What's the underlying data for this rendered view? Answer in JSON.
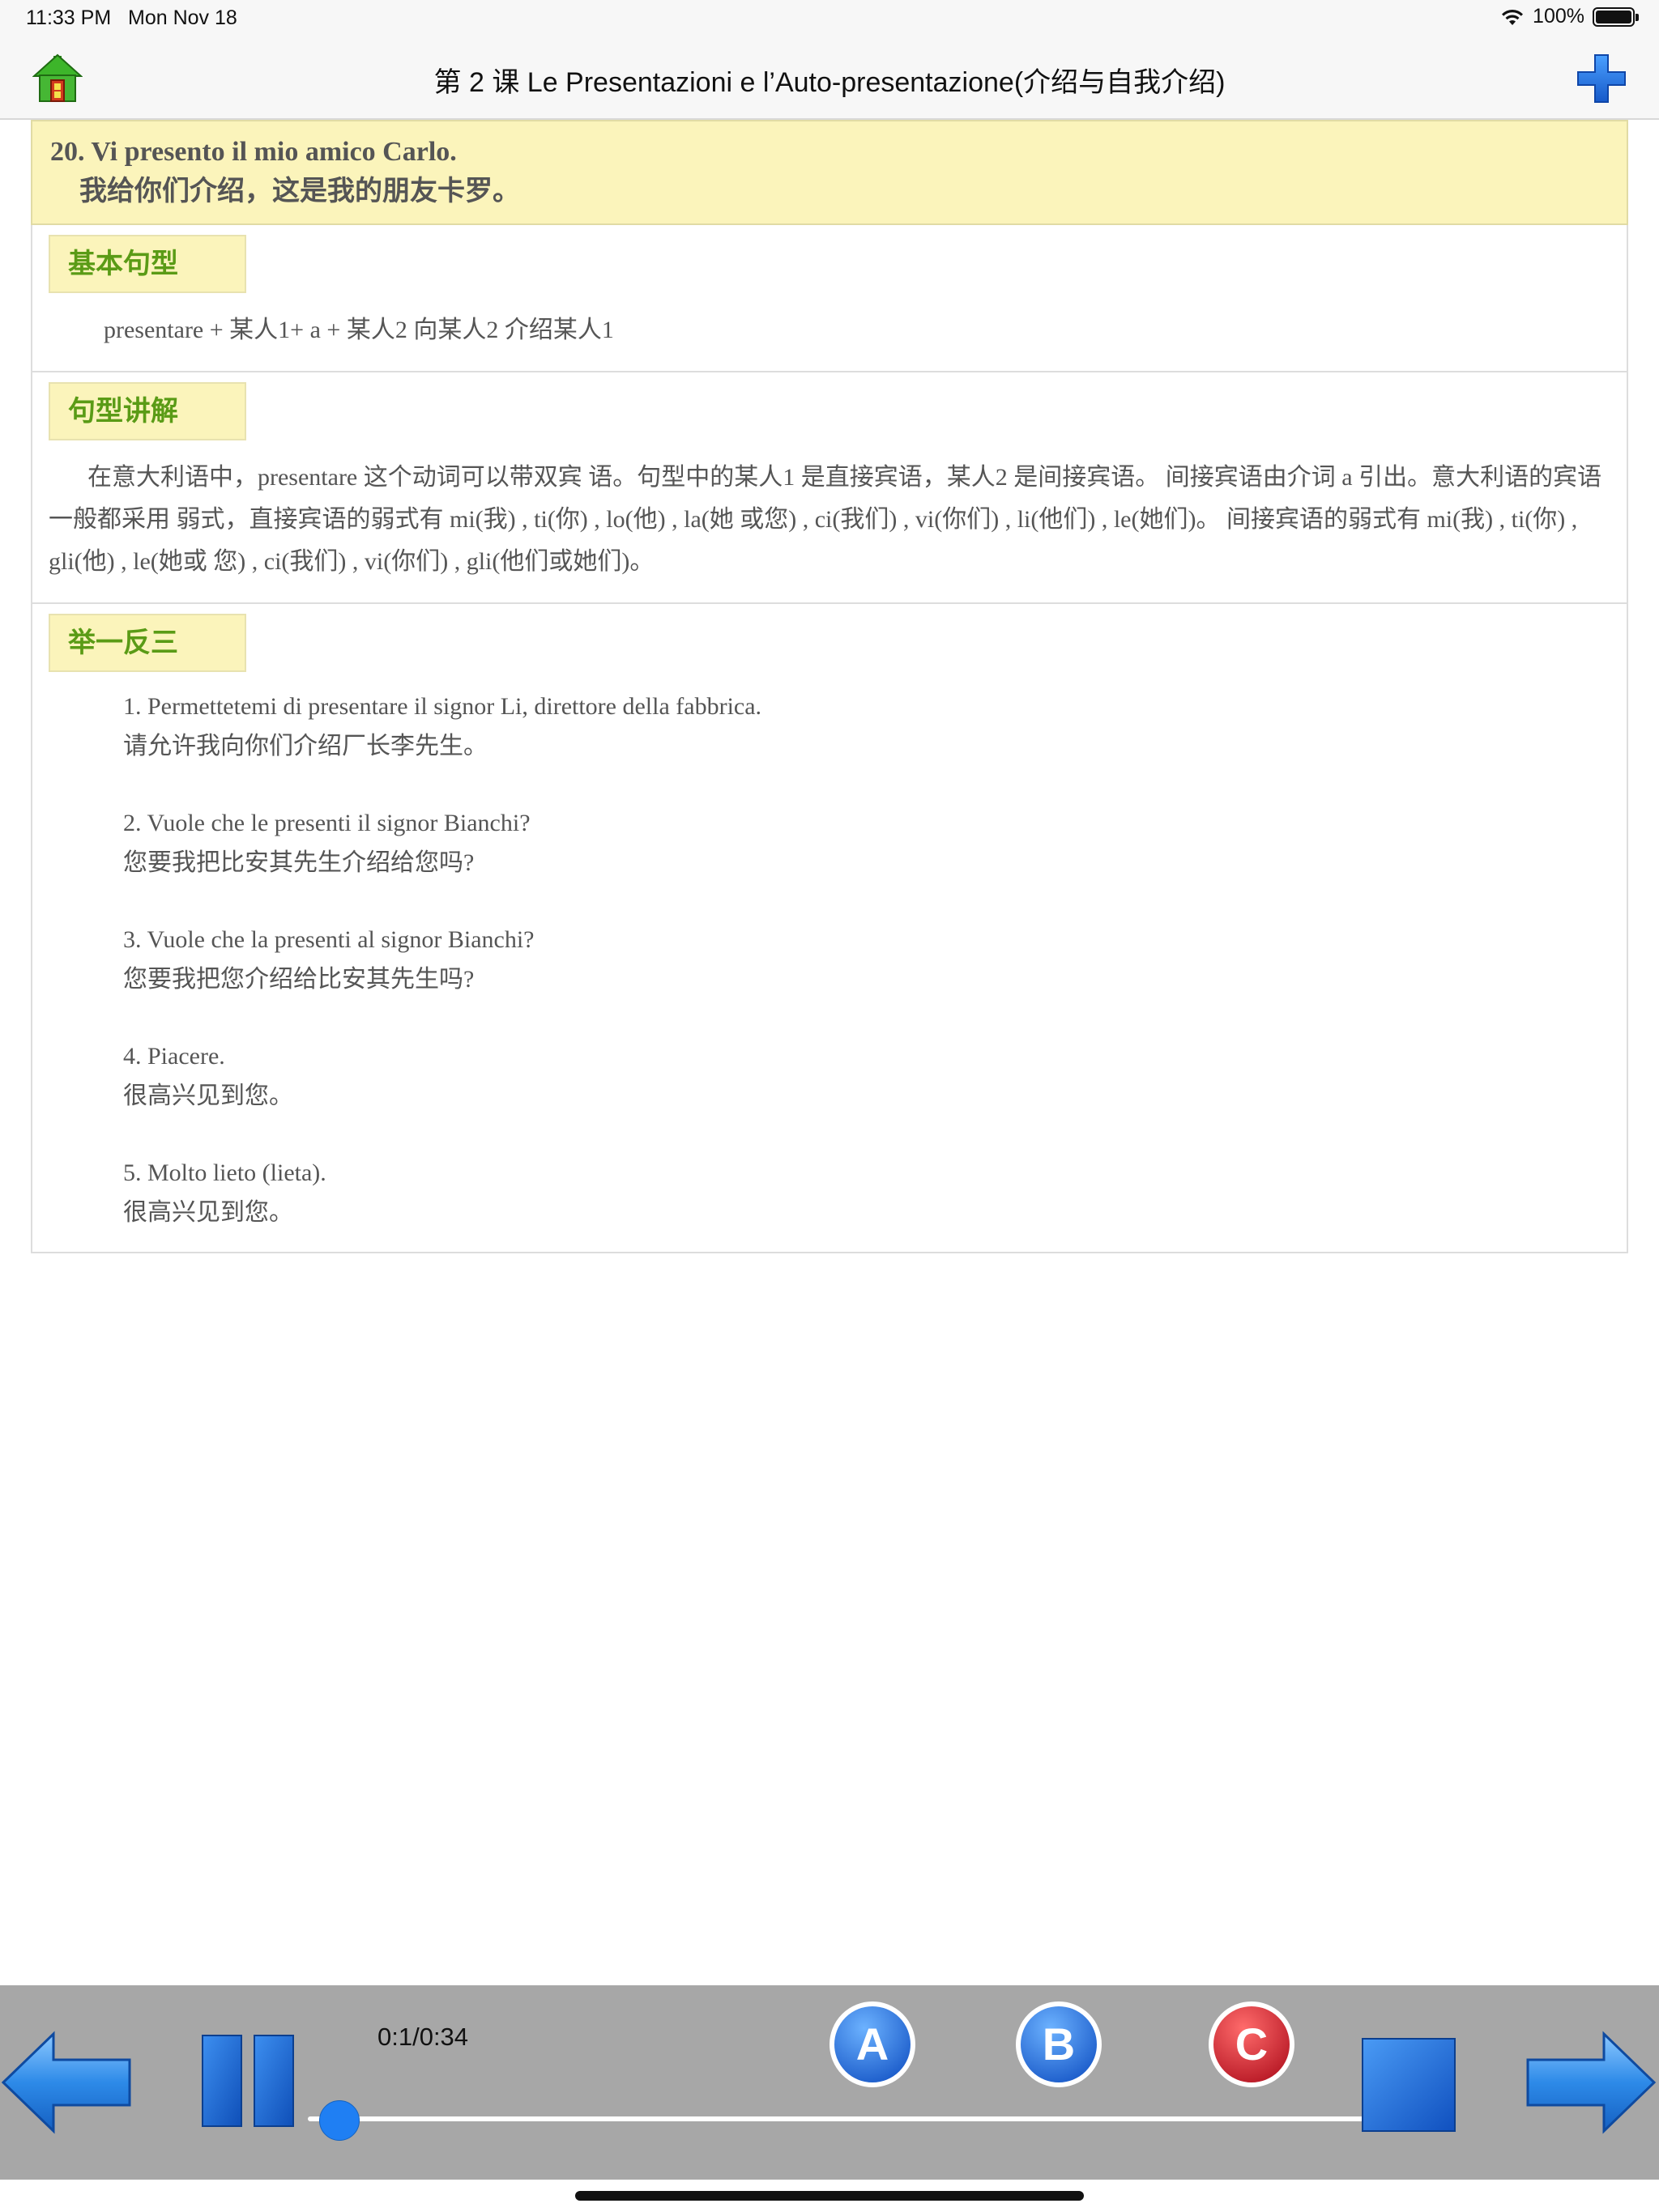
{
  "status_bar": {
    "time": "11:33 PM",
    "date": "Mon Nov 18",
    "battery": "100%"
  },
  "nav": {
    "title": "第 2 课 Le Presentazioni e l’Auto-presentazione(介绍与自我介绍)",
    "home_icon": "home-icon",
    "plus_icon": "plus-icon"
  },
  "lesson": {
    "italian": "20. Vi presento il mio amico Carlo.",
    "chinese": "我给你们介绍，这是我的朋友卡罗。"
  },
  "sections": {
    "basic_pattern": {
      "label": "基本句型",
      "text": "presentare + 某人1+ a + 某人2 向某人2 介绍某人1"
    },
    "explanation": {
      "label": "句型讲解",
      "text": "在意大利语中，presentare 这个动词可以带双宾 语。句型中的某人1 是直接宾语，某人2 是间接宾语。 间接宾语由介词 a 引出。意大利语的宾语一般都采用 弱式，直接宾语的弱式有 mi(我) , ti(你) , lo(他) , la(她 或您) , ci(我们) , vi(你们) , li(他们) , le(她们)。 间接宾语的弱式有 mi(我) , ti(你) , gli(他) , le(她或 您) , ci(我们) , vi(你们) , gli(他们或她们)。"
    },
    "examples": {
      "label": "举一反三",
      "items": [
        {
          "it": "1. Permettetemi di presentare il signor Li, direttore della fabbrica.",
          "zh": "请允许我向你们介绍厂长李先生。"
        },
        {
          "it": "2. Vuole che le presenti il signor Bianchi?",
          "zh": "您要我把比安其先生介绍给您吗?"
        },
        {
          "it": "3. Vuole che la presenti al signor Bianchi?",
          "zh": "您要我把您介绍给比安其先生吗?"
        },
        {
          "it": "4. Piacere.",
          "zh": "很高兴见到您。"
        },
        {
          "it": "5. Molto lieto (lieta).",
          "zh": "很高兴见到您。"
        }
      ]
    }
  },
  "player": {
    "time_readout": "0:1/0:34",
    "progress_fraction": 0.03,
    "button_a": "A",
    "button_b": "B",
    "button_c": "C",
    "accent_blue": "#1f7ff3",
    "c_red": "#d0182a"
  }
}
